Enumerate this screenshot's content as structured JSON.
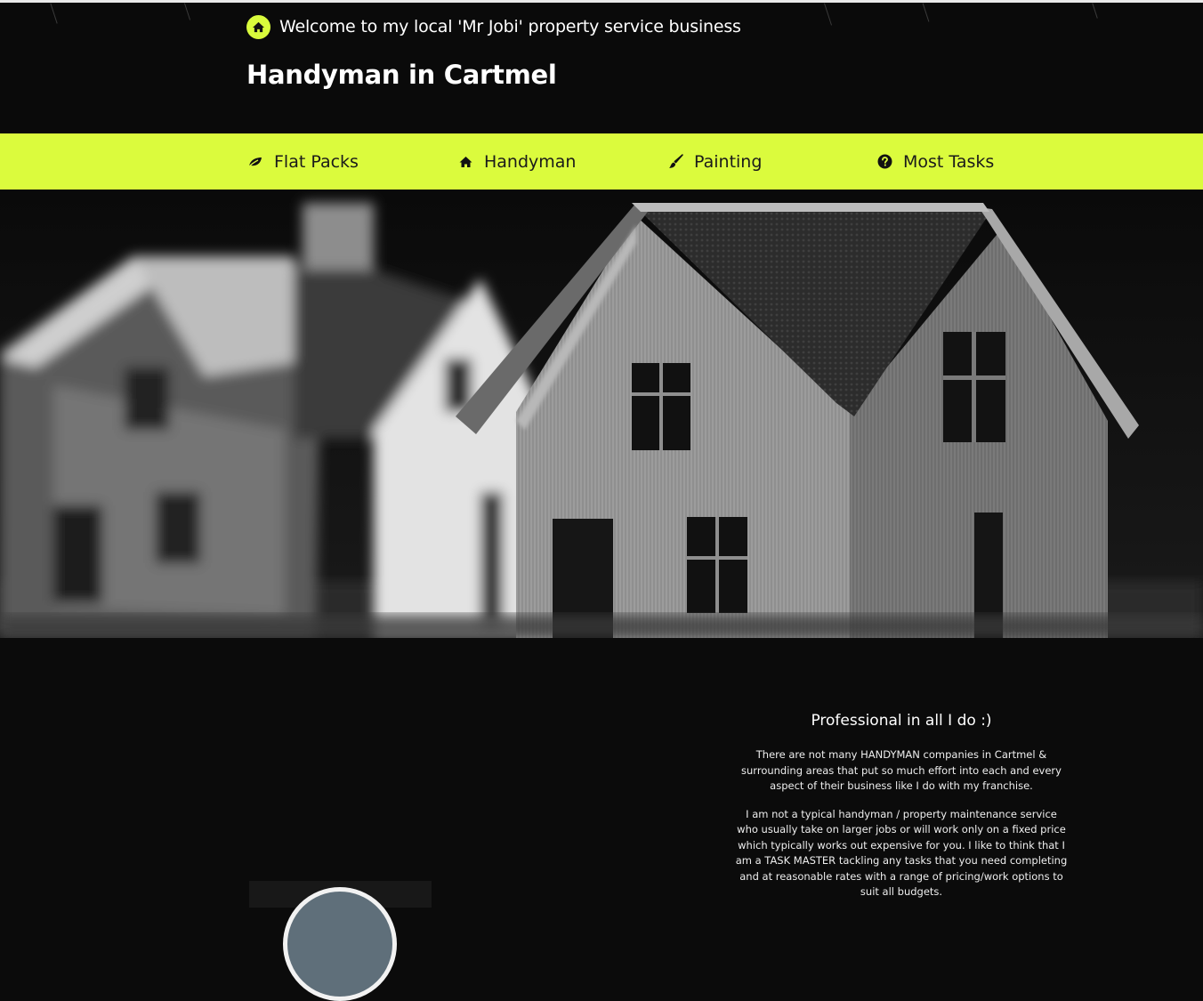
{
  "header": {
    "welcome_text": "Welcome to my local 'Mr Jobi' property service business",
    "welcome_icon": "home-icon",
    "title": "Handyman in Cartmel"
  },
  "nav": {
    "items": [
      {
        "label": "Flat Packs",
        "icon": "leaf-icon"
      },
      {
        "label": "Handyman",
        "icon": "home-icon"
      },
      {
        "label": "Painting",
        "icon": "paintbrush-icon"
      },
      {
        "label": "Most Tasks",
        "icon": "question-circle-icon"
      }
    ]
  },
  "about": {
    "heading": "Professional in all I do :)",
    "paragraphs": [
      "There are not many HANDYMAN companies in Cartmel & surrounding areas that put so much effort into each and every aspect of their business like I do with my franchise.",
      "I am not a typical handyman / property maintenance service who usually take on larger jobs or will work only on a fixed price which typically works out expensive for you. I like to think that I am a TASK MASTER tackling any tasks that you need completing and at reasonable rates with a range of pricing/work options to suit all budgets."
    ]
  },
  "colors": {
    "accent": "#dbfb3d",
    "background": "#0b0b0b",
    "text": "#ffffff"
  }
}
